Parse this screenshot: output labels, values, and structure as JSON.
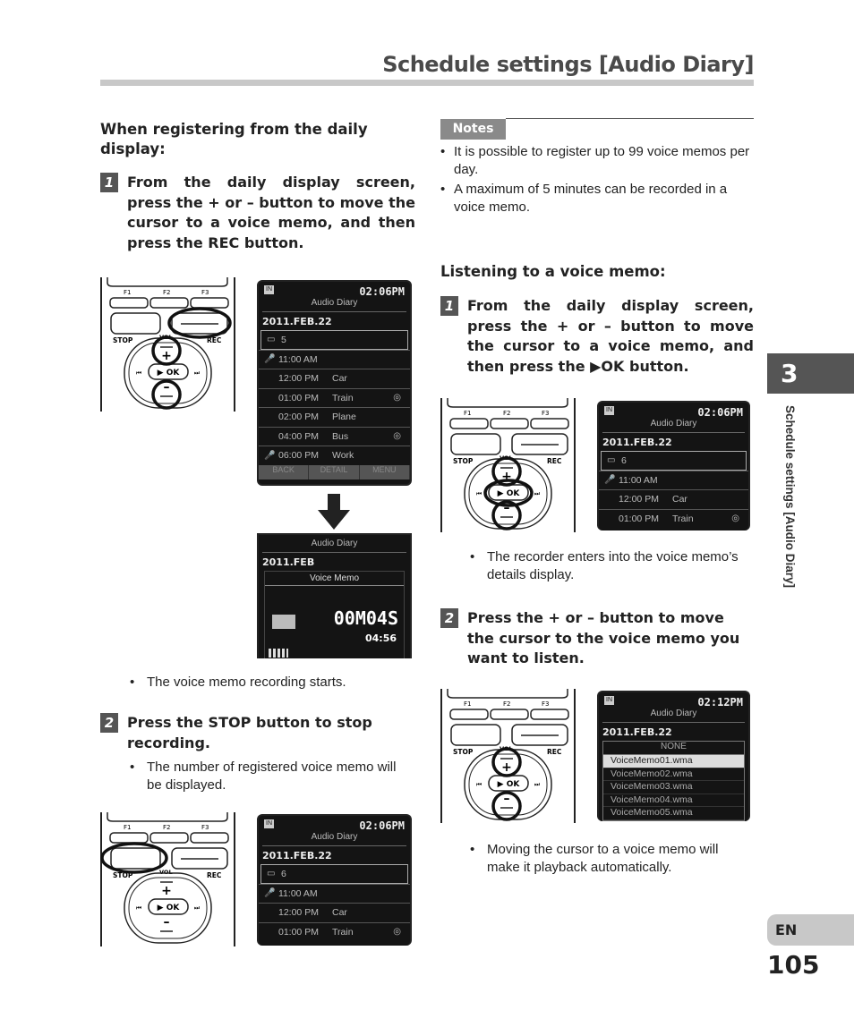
{
  "header": {
    "title": "Schedule settings [Audio Diary]"
  },
  "left": {
    "heading": "When registering from the daily display:",
    "step1": {
      "num": "1",
      "text": "From the daily display screen, press the + or – button to move the cursor to a voice memo, and then press the REC button."
    },
    "bullet1": "The voice memo recording starts.",
    "step2": {
      "num": "2",
      "text": "Press the STOP button to stop recording."
    },
    "bullet2": "The number of registered voice memo will be displayed."
  },
  "right": {
    "notes_label": "Notes",
    "notes": [
      "It is possible to register up to 99 voice memos per day.",
      "A maximum of 5 minutes can be recorded in a voice memo."
    ],
    "heading": "Listening to a voice memo:",
    "step1": {
      "num": "1",
      "text": "From the daily display screen, press the + or – button to move the cursor to a voice memo, and then press the ▶OK button."
    },
    "bullet1": "The recorder enters into the voice memo’s details display.",
    "step2": {
      "num": "2",
      "text": "Press the + or – button to move the cursor to the voice memo you want to listen."
    },
    "bullet2": "Moving the cursor to a voice memo will make it playback automatically."
  },
  "recorder": {
    "f1": "F1",
    "f2": "F2",
    "f3": "F3",
    "stop": "STOP",
    "rec": "REC",
    "vol": "VOL",
    "plus": "+",
    "minus": "–",
    "ok": "▶ OK",
    "prev": "⏮",
    "next": "⏭"
  },
  "recorders": [
    {
      "highlight": [
        "rec",
        "plus",
        "minus"
      ]
    },
    {
      "highlight": [
        "stop"
      ]
    },
    {
      "highlight": [
        "ok",
        "plus",
        "minus"
      ]
    },
    {
      "highlight": [
        "plus",
        "minus"
      ]
    }
  ],
  "screens": {
    "s1": {
      "in": "IN",
      "clock": "02:06PM",
      "title": "Audio Diary",
      "date": "2011.FEB.22",
      "count": "5",
      "rows": [
        {
          "icon": "mic",
          "time": "11:00 AM",
          "label": ""
        },
        {
          "time": "12:00 PM",
          "label": "Car"
        },
        {
          "time": "01:00 PM",
          "label": "Train",
          "ctr": true
        },
        {
          "time": "02:00 PM",
          "label": "Plane"
        },
        {
          "time": "04:00 PM",
          "label": "Bus",
          "ctr": true
        },
        {
          "icon": "mic",
          "time": "06:00 PM",
          "label": "Work"
        }
      ],
      "soft_keys": [
        "BACK",
        "DETAIL",
        "MENU"
      ]
    },
    "s2": {
      "title": "Audio Diary",
      "date": "2011.FEB",
      "popup": "Voice Memo",
      "elapsed": "00M04S",
      "remaining": "04:56"
    },
    "s3": {
      "in": "IN",
      "clock": "02:06PM",
      "title": "Audio Diary",
      "date": "2011.FEB.22",
      "count": "6",
      "rows": [
        {
          "icon": "mic",
          "time": "11:00 AM",
          "label": ""
        },
        {
          "time": "12:00 PM",
          "label": "Car"
        },
        {
          "time": "01:00 PM",
          "label": "Train",
          "ctr": true
        }
      ]
    },
    "s4": {
      "in": "IN",
      "clock": "02:06PM",
      "title": "Audio Diary",
      "date": "2011.FEB.22",
      "count": "6",
      "rows": [
        {
          "icon": "mic",
          "time": "11:00 AM",
          "label": ""
        },
        {
          "time": "12:00 PM",
          "label": "Car"
        },
        {
          "time": "01:00 PM",
          "label": "Train",
          "ctr": true
        }
      ]
    },
    "s5": {
      "in": "IN",
      "clock": "02:12PM",
      "title": "Audio Diary",
      "date": "2011.FEB.22",
      "none": "NONE",
      "files": [
        "VoiceMemo01.wma",
        "VoiceMemo02.wma",
        "VoiceMemo03.wma",
        "VoiceMemo04.wma",
        "VoiceMemo05.wma"
      ]
    }
  },
  "side": {
    "chapter": "3",
    "section": "Schedule settings [Audio Diary]",
    "lang": "EN",
    "page": "105"
  }
}
